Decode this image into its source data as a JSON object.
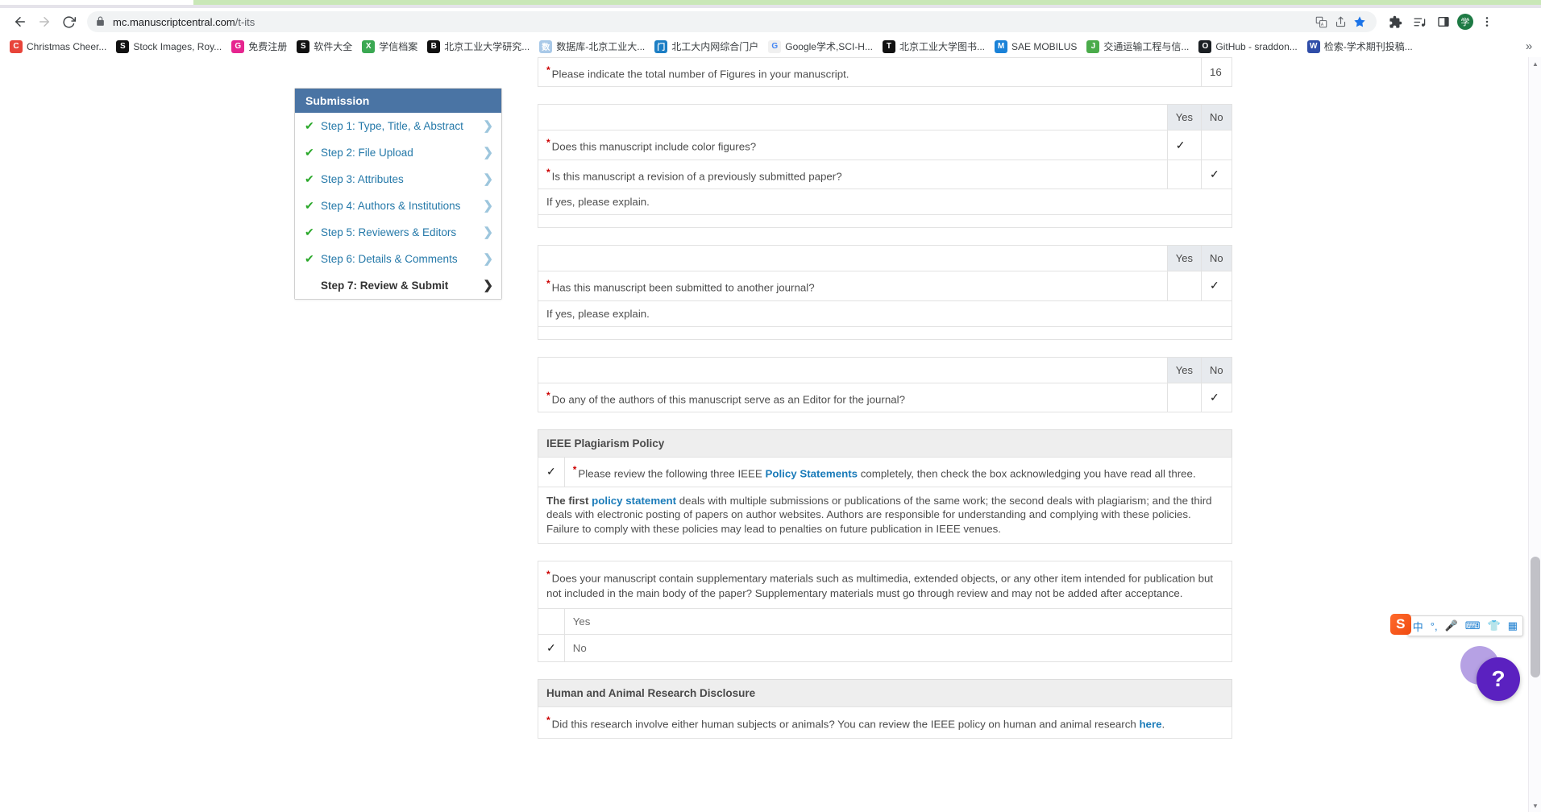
{
  "browser": {
    "back_title": "Back",
    "forward_title": "Forward",
    "reload_title": "Reload",
    "url_domain": "mc.manuscriptcentral.com",
    "url_path": "/t-its",
    "avatar_label": "学",
    "overflow_label": "»",
    "icons": {
      "translate": "translate-icon",
      "share": "share-icon",
      "bookmark_star": "bookmark-star-icon",
      "extensions": "extensions-puzzle-icon",
      "media": "media-playlist-icon",
      "side_panel": "side-panel-icon",
      "menu": "three-dot-menu-icon"
    },
    "bookmarks": [
      {
        "label": "Christmas Cheer...",
        "color": "#e8443a",
        "glyph": "C"
      },
      {
        "label": "Stock Images, Roy...",
        "color": "#111111",
        "glyph": "S"
      },
      {
        "label": "免费注册",
        "color": "#e6258f",
        "glyph": "G"
      },
      {
        "label": "软件大全",
        "color": "#111111",
        "glyph": "S"
      },
      {
        "label": "学信档案",
        "color": "#3aa852",
        "glyph": "X"
      },
      {
        "label": "北京工业大学研究...",
        "color": "#111111",
        "glyph": "B"
      },
      {
        "label": "数据库-北京工业大...",
        "color": "#a9c9e8",
        "glyph": "数"
      },
      {
        "label": "北工大内网综合门户",
        "color": "#1c7ec4",
        "glyph": "门"
      },
      {
        "label": "Google学术,SCI-H...",
        "color": "#f0f0f0",
        "glyph": "G"
      },
      {
        "label": "北京工业大学图书...",
        "color": "#111111",
        "glyph": "T"
      },
      {
        "label": "SAE MOBILUS",
        "color": "#1a82d8",
        "glyph": "M"
      },
      {
        "label": "交通运输工程与信...",
        "color": "#4aab4a",
        "glyph": "J"
      },
      {
        "label": "GitHub - sraddon...",
        "color": "#1b1f23",
        "glyph": "O"
      },
      {
        "label": "检索-学术期刊投稿...",
        "color": "#2f4da8",
        "glyph": "W"
      }
    ]
  },
  "sidebar": {
    "title": "Submission",
    "items": [
      {
        "label": "Step 1: Type, Title, & Abstract",
        "done": true,
        "current": false
      },
      {
        "label": "Step 2: File Upload",
        "done": true,
        "current": false
      },
      {
        "label": "Step 3: Attributes",
        "done": true,
        "current": false
      },
      {
        "label": "Step 4: Authors & Institutions",
        "done": true,
        "current": false
      },
      {
        "label": "Step 5: Reviewers & Editors",
        "done": true,
        "current": false
      },
      {
        "label": "Step 6: Details & Comments",
        "done": true,
        "current": false
      },
      {
        "label": "Step 7: Review & Submit",
        "done": false,
        "current": true
      }
    ],
    "check_glyph": "✔",
    "chevron_glyph": "❯"
  },
  "form": {
    "figures": {
      "question": "Please indicate the total number of Figures in your manuscript.",
      "value": "16"
    },
    "yes_label": "Yes",
    "no_label": "No",
    "check_glyph": "✓",
    "group1": {
      "rows": [
        {
          "question": "Does this manuscript include color figures?",
          "answer": "Yes"
        },
        {
          "question": "Is this manuscript a revision of a previously submitted paper?",
          "answer": "No"
        }
      ],
      "explain_label": "If yes, please explain.",
      "explain_value": ""
    },
    "group2": {
      "rows": [
        {
          "question": "Has this manuscript been submitted to another journal?",
          "answer": "No"
        }
      ],
      "explain_label": "If yes, please explain.",
      "explain_value": ""
    },
    "group3": {
      "rows": [
        {
          "question": "Do any of the authors of this manuscript serve as an Editor for the journal?",
          "answer": "No"
        }
      ]
    },
    "plagiarism": {
      "heading": "IEEE Plagiarism Policy",
      "checked": true,
      "ack_before": "Please review the following three IEEE ",
      "ack_link": "Policy Statements",
      "ack_after": " completely, then check the box acknowledging you have read all three.",
      "body_bold": "The first ",
      "body_link": "policy statement",
      "body_rest": " deals with multiple submissions or publications of the same work; the second deals with plagiarism; and the third deals with electronic posting of papers on author websites. Authors are responsible for understanding and complying with these policies. Failure to comply with these policies may lead to penalties on future publication in IEEE venues."
    },
    "supplementary": {
      "question": "Does your manuscript contain supplementary materials such as multimedia, extended objects, or any other item intended for publication but not included in the main body of the paper? Supplementary materials must go through review and may not be added after acceptance.",
      "options": [
        {
          "label": "Yes",
          "selected": false
        },
        {
          "label": "No",
          "selected": true
        }
      ]
    },
    "human_animal": {
      "heading": "Human and Animal Research Disclosure",
      "question_before": "Did this research involve either human subjects or animals? You can review the IEEE policy on human and animal research ",
      "question_link": "here",
      "question_after": "."
    }
  },
  "ime": {
    "logo": "S",
    "items": [
      {
        "label": "中",
        "name": "ime-language-toggle"
      },
      {
        "label": "°,",
        "name": "ime-punctuation-toggle"
      },
      {
        "label": "🎤",
        "name": "ime-microphone-icon"
      },
      {
        "label": "⌨",
        "name": "ime-keyboard-icon"
      },
      {
        "label": "👕",
        "name": "ime-skin-icon"
      },
      {
        "label": "▦",
        "name": "ime-toolbox-icon"
      }
    ]
  },
  "help": {
    "label": "?"
  },
  "scrollbar": {
    "up_glyph": "▲",
    "down_glyph": "▼"
  }
}
